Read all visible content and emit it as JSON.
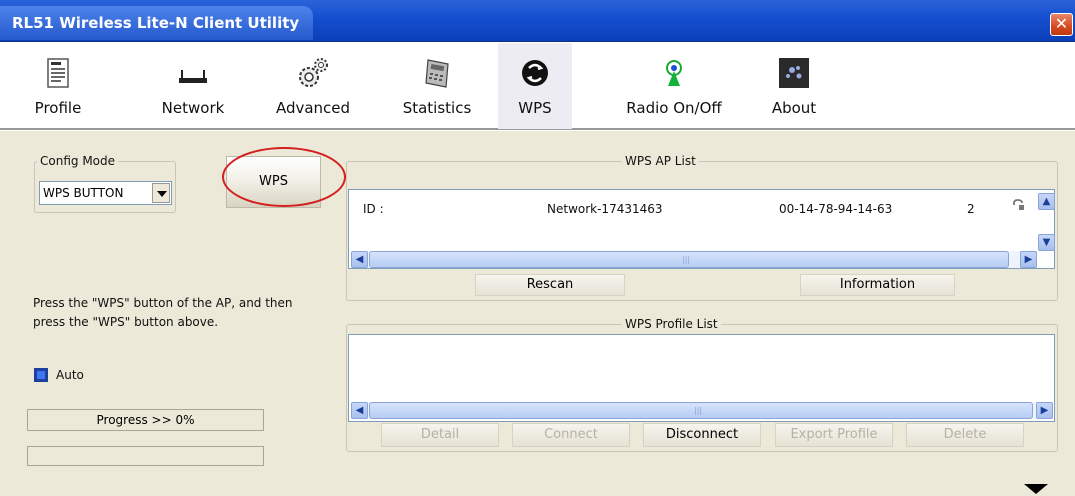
{
  "window": {
    "title": "RL51 Wireless Lite-N Client Utility"
  },
  "toolbar": {
    "items": [
      {
        "label": "Profile",
        "icon": "profile-icon"
      },
      {
        "label": "Network",
        "icon": "network-icon"
      },
      {
        "label": "Advanced",
        "icon": "advanced-gear-icon"
      },
      {
        "label": "Statistics",
        "icon": "statistics-icon"
      },
      {
        "label": "WPS",
        "icon": "wps-icon",
        "active": true
      },
      {
        "label": "Radio On/Off",
        "icon": "radio-icon"
      },
      {
        "label": "About",
        "icon": "about-icon"
      }
    ]
  },
  "config": {
    "group_title": "Config Mode",
    "mode_value": "WPS BUTTON",
    "wps_button": "WPS"
  },
  "instructions": {
    "line1": "Press the \"WPS\" button of the AP, and then",
    "line2": "press the \"WPS\" button above."
  },
  "auto": {
    "label": "Auto",
    "checked": true
  },
  "progress": {
    "label": "Progress >> 0%",
    "value": 0
  },
  "ap_list": {
    "title": "WPS AP List",
    "row": {
      "id_label": "ID :",
      "ssid": "Network-17431463",
      "bssid": "00-14-78-94-14-63",
      "channel": "2"
    },
    "rescan": "Rescan",
    "information": "Information"
  },
  "profile_list": {
    "title": "WPS Profile List",
    "buttons": {
      "detail": "Detail",
      "connect": "Connect",
      "disconnect": "Disconnect",
      "export": "Export Profile",
      "delete": "Delete"
    }
  },
  "colors": {
    "titlebar": "#1650d0",
    "main_bg": "#ece9d8",
    "highlight_circle": "#d41f1f"
  }
}
